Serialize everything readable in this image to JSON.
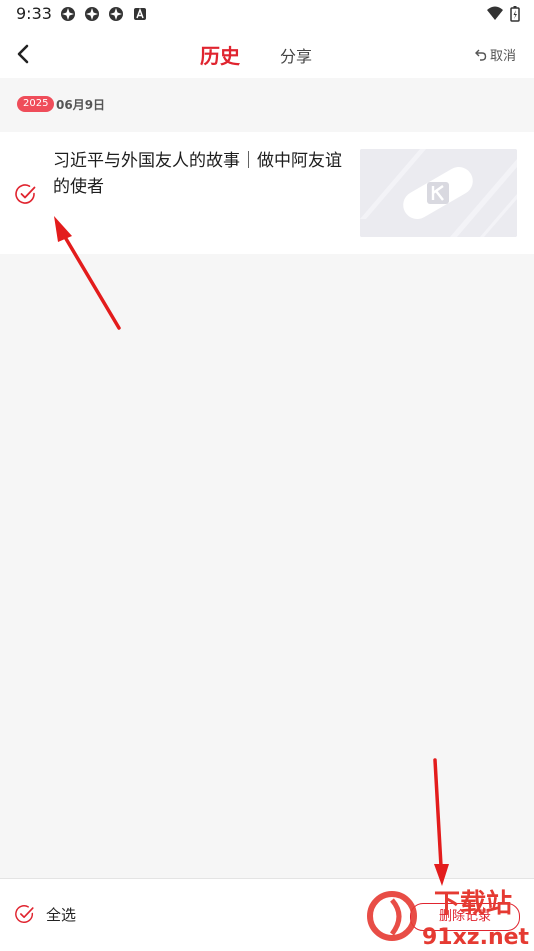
{
  "status_bar": {
    "time": "9:33"
  },
  "header": {
    "tab_active": "历史",
    "tab_inactive": "分享",
    "cancel_label": "取消"
  },
  "history": {
    "year_badge": "2025",
    "date": "06月9日",
    "items": [
      {
        "title": "习近平与外国友人的故事｜做中阿友谊的使者",
        "selected": true
      }
    ]
  },
  "bottom_bar": {
    "select_all_label": "全选",
    "delete_label": "删除记录"
  },
  "watermark": {
    "line1": "下载站",
    "line2": "91xz.net"
  },
  "colors": {
    "accent": "#e0242f",
    "background": "#f6f6f6",
    "surface": "#ffffff"
  }
}
